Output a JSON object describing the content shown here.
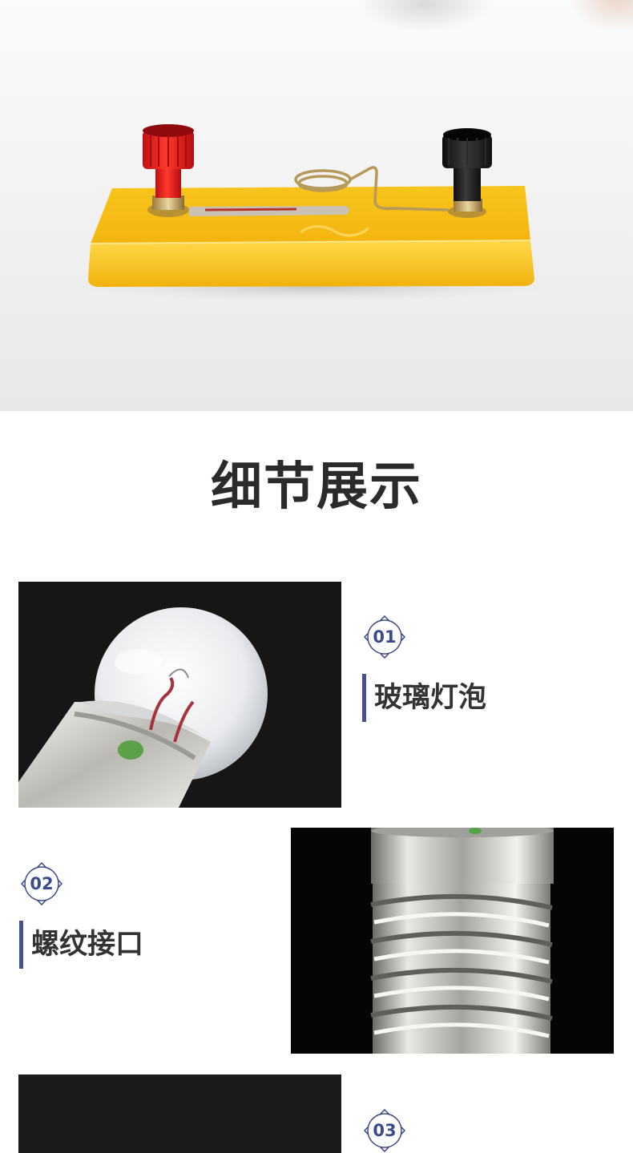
{
  "section": {
    "title": "细节展示"
  },
  "details": [
    {
      "number": "01",
      "label": "玻璃灯泡"
    },
    {
      "number": "02",
      "label": "螺纹接口"
    },
    {
      "number": "03"
    }
  ],
  "colors": {
    "accent": "#44508f",
    "badge_text": "#3b4a8a",
    "title_text": "#2b2b2b",
    "label_text": "#333333",
    "switch_base": "#f6c21c",
    "terminal_red": "#e41d1d",
    "terminal_black": "#1c1c1c"
  }
}
